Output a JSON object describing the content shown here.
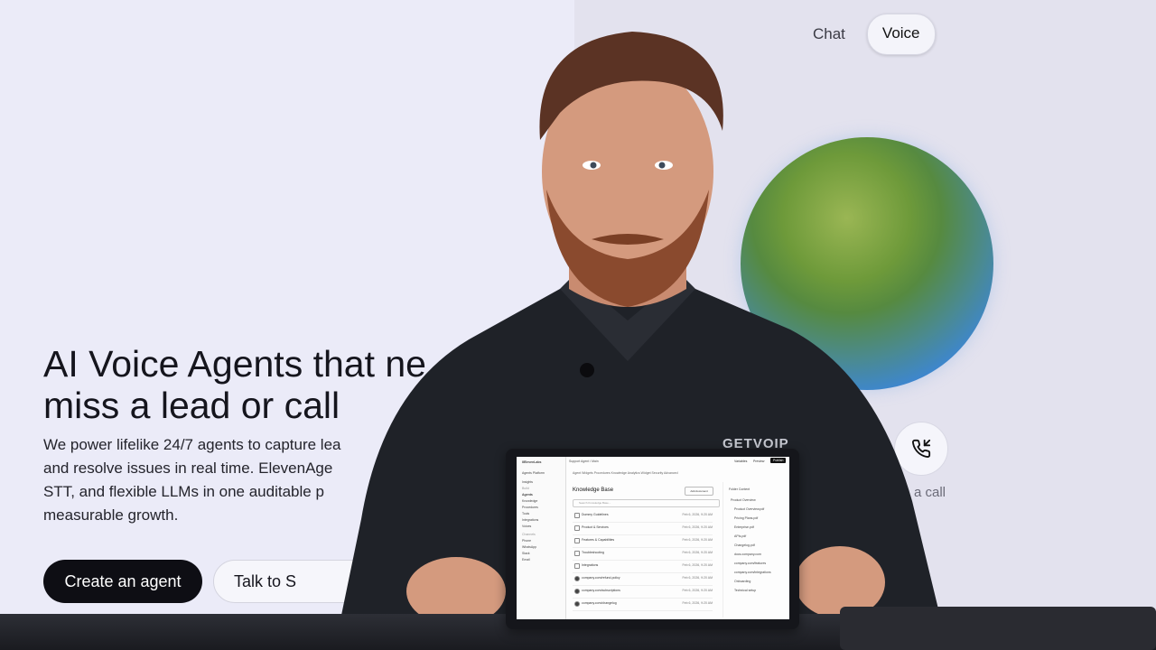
{
  "mode_toggle": {
    "chat_label": "Chat",
    "voice_label": "Voice"
  },
  "hero": {
    "headline_line1": "AI Voice Agents that ne",
    "headline_line2": "miss a lead or call",
    "sub_line1": "We power lifelike 24/7 agents to capture lea",
    "sub_line2": "and resolve issues in real time. ElevenAge",
    "sub_line3": "STT, and flexible LLMs in one auditable p",
    "sub_line4": "measurable growth.",
    "primary_cta": "Create an agent",
    "secondary_cta": "Talk to S"
  },
  "call": {
    "label": "a call"
  },
  "shirt_logo": "GETVOIP",
  "tablet": {
    "brand": "IIElevenLabs",
    "breadcrumb": "Support Agent  /  Main",
    "top_actions": [
      "Variables",
      "Preview",
      "Publish"
    ],
    "tabs": "Agent  Widgets  Procedures  Knowledge  Analytics  Widget  Security  Advanced",
    "section_title": "Knowledge Base",
    "add_button": "Add document",
    "search_placeholder": "Search Knowledge Base...",
    "side_items": [
      "Agents Platform",
      "Insights",
      "Build",
      "Agents",
      "Knowledge",
      "Procedures",
      "Tools",
      "Integrations",
      "Voices",
      "Channels",
      "Phone",
      "WhatsApp",
      "Slack",
      "Email"
    ],
    "rows": [
      {
        "name": "Dummy Guidelines",
        "date": "Feb 6, 2026, 9:20 AM"
      },
      {
        "name": "Product & Services",
        "date": "Feb 6, 2026, 9:20 AM"
      },
      {
        "name": "Features & Capabilities",
        "date": "Feb 6, 2026, 9:20 AM"
      },
      {
        "name": "Troubleshooting",
        "date": "Feb 6, 2026, 9:20 AM"
      },
      {
        "name": "Integrations",
        "date": "Feb 6, 2026, 9:20 AM"
      },
      {
        "name": "company.com/refund-policy",
        "date": "Feb 6, 2026, 9:20 AM"
      },
      {
        "name": "company.com/subscriptions",
        "date": "Feb 6, 2026, 9:20 AM"
      },
      {
        "name": "company.com/changelog",
        "date": "Feb 6, 2026, 9:20 AM"
      }
    ],
    "right_header": "Folder Content",
    "right_items": [
      "Product Overview",
      "Product Overview.pdf",
      "Pricing Plans.pdf",
      "Enterprise.pdf",
      "APIs.pdf",
      "Changelog.pdf",
      "docs.company.com",
      "company.com/features",
      "company.com/integrations",
      "Onboarding",
      "Technical setup"
    ]
  },
  "colors": {
    "primary_button": "#0e0e14",
    "orb_green": "#6e9a3a",
    "orb_blue": "#3c86d6"
  }
}
